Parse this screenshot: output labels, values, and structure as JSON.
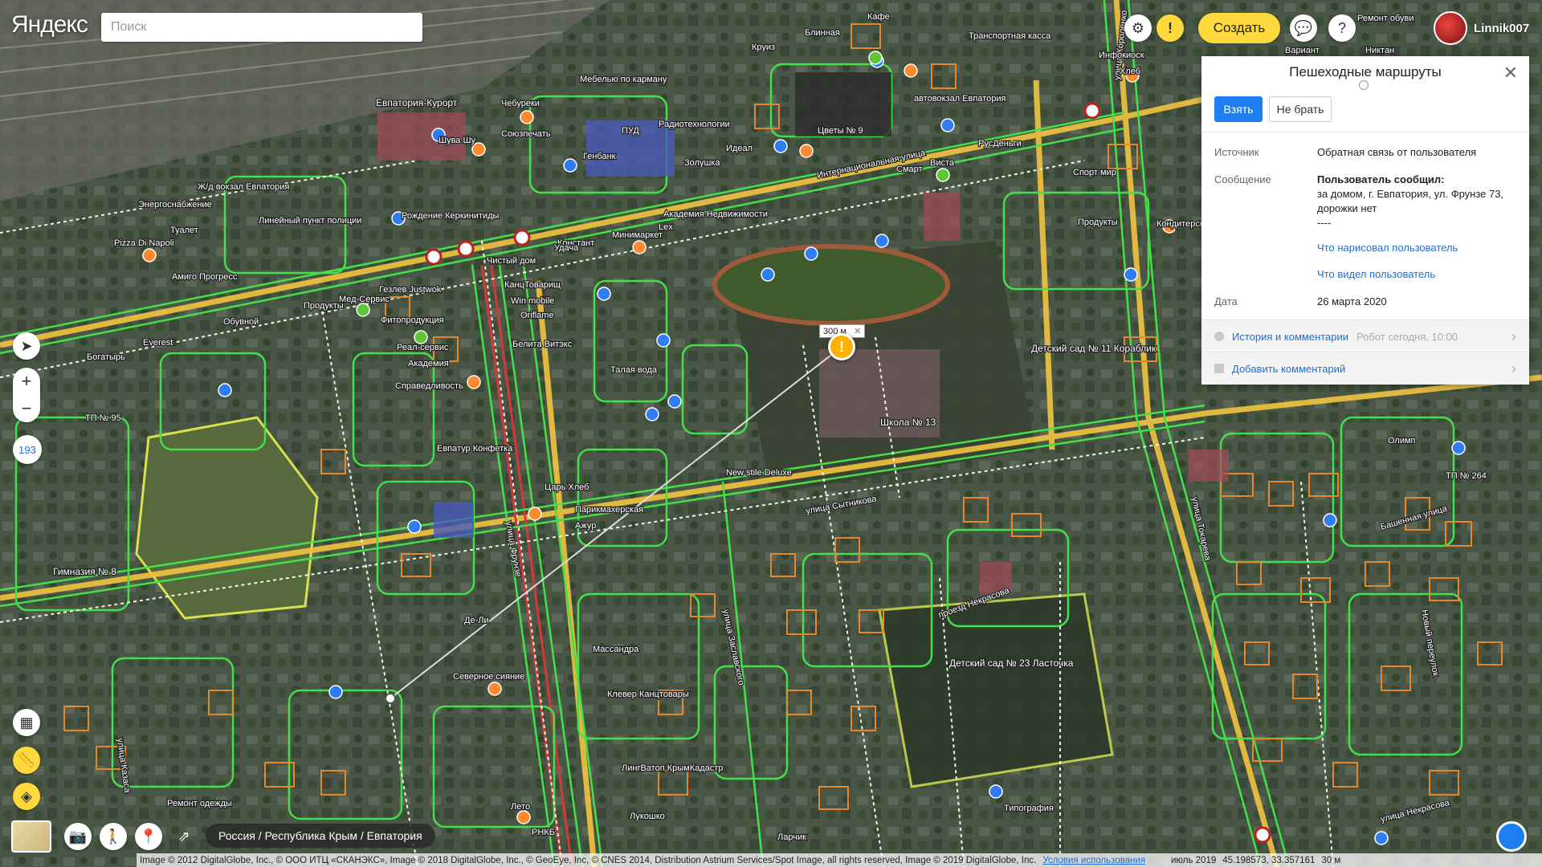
{
  "header": {
    "logo": "Яндекс",
    "search_placeholder": "Поиск",
    "create_label": "Создать",
    "user_name": "Linnik007",
    "alert_glyph": "!",
    "help_glyph": "?"
  },
  "panel": {
    "title": "Пешеходные маршруты",
    "take_label": "Взять",
    "skip_label": "Не брать",
    "rows": {
      "source_label": "Источник",
      "source_value": "Обратная связь от пользователя",
      "message_label": "Сообщение",
      "message_heading": "Пользователь сообщил:",
      "message_text": "за домом, г. Евпатория, ул. Фрунзе 73, дорожки нет",
      "message_sep": "----",
      "link_drawn": "Что нарисовал пользователь",
      "link_seen": "Что видел пользователь",
      "date_label": "Дата",
      "date_value": "26 марта 2020"
    },
    "history_label": "История и комментарии",
    "history_meta": "Робот сегодня, 10:00",
    "add_comment_label": "Добавить комментарий"
  },
  "map": {
    "ruler_distance": "300 м",
    "zoom_level": "193",
    "breadcrumb": "Россия / Республика Крым / Евпатория",
    "copyright": "Image © 2012 DigitalGlobe, Inc., © ООО ИТЦ «СКАНЭКС», Image © 2018 DigitalGlobe, Inc., © GeoEye, Inc, © CNES 2014, Distribution Astrium Services/Spot Image, all rights reserved, Image © 2019 DigitalGlobe, Inc.",
    "terms_link": "Условия использования",
    "imagery_date": "июль 2019",
    "coordinates": "45.198573, 33.357161",
    "scale": "30 м",
    "labels": [
      {
        "text": "Евпатория-Курорт"
      },
      {
        "text": "Ж/д вокзал Евпатория"
      },
      {
        "text": "Линейный пункт полиции"
      },
      {
        "text": "Энергоснабжение"
      },
      {
        "text": "Туалет"
      },
      {
        "text": "Pizza Di Napoli"
      },
      {
        "text": "Амиго Прогресс"
      },
      {
        "text": "Рождение Керкинитиды"
      },
      {
        "text": "ПУД"
      },
      {
        "text": "Генбанк"
      },
      {
        "text": "Мебелью по карману"
      },
      {
        "text": "Радиотехнологии"
      },
      {
        "text": "Шува Шу"
      },
      {
        "text": "Чебуреки"
      },
      {
        "text": "Союзпечать"
      },
      {
        "text": "Цветы № 9"
      },
      {
        "text": "автовокзал Евпатория"
      },
      {
        "text": "Транспортная касса"
      },
      {
        "text": "Интернациональная улица"
      },
      {
        "text": "Академия Недвижимости"
      },
      {
        "text": "Минимаркет"
      },
      {
        "text": "Чистый дом"
      },
      {
        "text": "КанцТоварищ"
      },
      {
        "text": "Win mobile"
      },
      {
        "text": "Oriflame"
      },
      {
        "text": "Белита Витэкс"
      },
      {
        "text": "Талая вода"
      },
      {
        "text": "Мед-Сервис"
      },
      {
        "text": "Фитопродукция"
      },
      {
        "text": "Реал-сервис"
      },
      {
        "text": "Академия"
      },
      {
        "text": "Справедливость"
      },
      {
        "text": "Обувной"
      },
      {
        "text": "Богатырь"
      },
      {
        "text": "Everest"
      },
      {
        "text": "Евпатур Конфетка"
      },
      {
        "text": "Царь Хлеб"
      },
      {
        "text": "Парикмахерская"
      },
      {
        "text": "New stile Deluxe"
      },
      {
        "text": "Школа № 13"
      },
      {
        "text": "Детский сад № 11 Кораблик"
      },
      {
        "text": "улица Сытникова"
      },
      {
        "text": "улица Фрунзе"
      },
      {
        "text": "улица Заславского"
      },
      {
        "text": "улица Токарева"
      },
      {
        "text": "улица Короленко"
      },
      {
        "text": "Гимназия № 8"
      },
      {
        "text": "Северное сияние"
      },
      {
        "text": "Массандра"
      },
      {
        "text": "Клевер Канцтовары"
      },
      {
        "text": "ЛингВатоп КрымКадастр"
      },
      {
        "text": "Лукошко"
      },
      {
        "text": "Ремонт одежды"
      },
      {
        "text": "Детский сад № 23 Ласточка"
      },
      {
        "text": "проезд Некрасова"
      },
      {
        "text": "Типография"
      },
      {
        "text": "Башенная улица"
      },
      {
        "text": "Новый переулок"
      },
      {
        "text": "улица Некрасова"
      },
      {
        "text": "Олимп"
      },
      {
        "text": "ТП № 264"
      },
      {
        "text": "Кондитерская"
      },
      {
        "text": "Продукты"
      },
      {
        "text": "Спорт мир"
      },
      {
        "text": "РусДеньги"
      },
      {
        "text": "Смарт"
      },
      {
        "text": "Виста"
      },
      {
        "text": "Кафе"
      },
      {
        "text": "Хлеб"
      },
      {
        "text": "Инфокиоск"
      },
      {
        "text": "Ремонт обуви"
      },
      {
        "text": "Никтан"
      },
      {
        "text": "Вариант"
      },
      {
        "text": "Круиз"
      },
      {
        "text": "Блинная"
      },
      {
        "text": "Золушка"
      },
      {
        "text": "Идеал"
      },
      {
        "text": "Lex"
      },
      {
        "text": "Констант"
      },
      {
        "text": "Удача"
      },
      {
        "text": "Гезлев Justwok"
      },
      {
        "text": "Продукты"
      },
      {
        "text": "ТП № 95"
      },
      {
        "text": "улица Казаса"
      },
      {
        "text": "Летo"
      },
      {
        "text": "Ларчик"
      },
      {
        "text": "РНКБ"
      },
      {
        "text": "Ажур"
      },
      {
        "text": "Де-Ли"
      }
    ]
  }
}
